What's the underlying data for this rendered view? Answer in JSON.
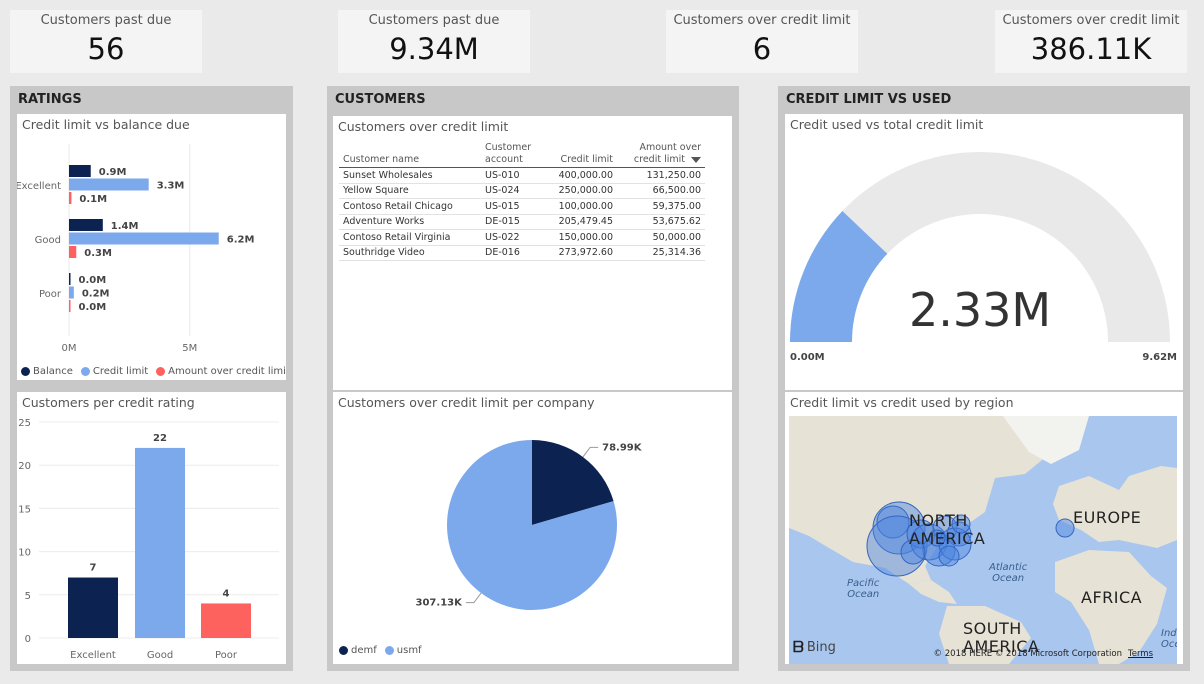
{
  "kpis": [
    {
      "label": "Customers past due",
      "value": "56"
    },
    {
      "label": "Customers past due",
      "value": "9.34M"
    },
    {
      "label": "Customers over credit limit",
      "value": "6"
    },
    {
      "label": "Customers over credit limit",
      "value": "386.11K"
    }
  ],
  "groups": {
    "ratings": "RATINGS",
    "customers": "CUSTOMERS",
    "credit": "CREDIT LIMIT VS USED"
  },
  "colors": {
    "balance": "#0c2352",
    "credit_limit": "#7ca9ec",
    "over_limit": "#fd625e"
  },
  "credit_balance_chart": {
    "title": "Credit limit vs balance due",
    "legend": [
      "Balance",
      "Credit limit",
      "Amount over credit limit"
    ],
    "x_ticks": [
      "0M",
      "5M"
    ]
  },
  "rating_count_chart": {
    "title": "Customers per credit rating",
    "y_ticks": [
      "0",
      "5",
      "10",
      "15",
      "20",
      "25"
    ]
  },
  "customers_table": {
    "title": "Customers over credit limit",
    "headers": [
      "Customer name",
      "Customer account",
      "Credit limit",
      "Amount over credit limit"
    ],
    "rows": [
      [
        "Sunset Wholesales",
        "US-010",
        "400,000.00",
        "131,250.00"
      ],
      [
        "Yellow Square",
        "US-024",
        "250,000.00",
        "66,500.00"
      ],
      [
        "Contoso Retail Chicago",
        "US-015",
        "100,000.00",
        "59,375.00"
      ],
      [
        "Adventure Works",
        "DE-015",
        "205,479.45",
        "53,675.62"
      ],
      [
        "Contoso Retail Virginia",
        "US-022",
        "150,000.00",
        "50,000.00"
      ],
      [
        "Southridge Video",
        "DE-016",
        "273,972.60",
        "25,314.36"
      ]
    ]
  },
  "pie_chart": {
    "title": "Customers over credit limit per company",
    "legend": [
      "demf",
      "usmf"
    ]
  },
  "gauge_chart": {
    "title": "Credit used vs total credit limit",
    "value_label": "2.33M",
    "min_label": "0.00M",
    "max_label": "9.62M"
  },
  "map": {
    "title": "Credit limit vs credit used by region",
    "labels": {
      "north_america": "NORTH\nAMERICA",
      "south_america": "SOUTH\nAMERICA",
      "europe": "EUROPE",
      "africa": "AFRICA",
      "pacific": "Pacific\nOcean",
      "atlantic": "Atlantic\nOcean",
      "indian": "Ind\nOce"
    },
    "bing": "Bing",
    "attribution": "© 2018 HERE  © 2018 Microsoft Corporation",
    "terms": "Terms"
  },
  "chart_data": [
    {
      "type": "bar",
      "orientation": "horizontal",
      "title": "Credit limit vs balance due",
      "categories": [
        "Excellent",
        "Good",
        "Poor"
      ],
      "series": [
        {
          "name": "Balance",
          "values": [
            0.9,
            1.4,
            0.0
          ],
          "labels": [
            "0.9M",
            "1.4M",
            "0.0M"
          ]
        },
        {
          "name": "Credit limit",
          "values": [
            3.3,
            6.2,
            0.2
          ],
          "labels": [
            "3.3M",
            "6.2M",
            "0.2M"
          ]
        },
        {
          "name": "Amount over credit limit",
          "values": [
            0.1,
            0.3,
            0.0
          ],
          "labels": [
            "0.1M",
            "0.3M",
            "0.0M"
          ]
        }
      ],
      "xlim": [
        0,
        5.3
      ],
      "legend": "bottom"
    },
    {
      "type": "bar",
      "title": "Customers per credit rating",
      "categories": [
        "Excellent",
        "Good",
        "Poor"
      ],
      "values": [
        7,
        22,
        4
      ],
      "ylim": [
        0,
        25
      ]
    },
    {
      "type": "pie",
      "title": "Customers over credit limit per company",
      "categories": [
        "demf",
        "usmf"
      ],
      "values": [
        78.99,
        307.13
      ],
      "labels": [
        "78.99K",
        "307.13K"
      ],
      "legend": "bottom-left"
    },
    {
      "type": "gauge",
      "title": "Credit used vs total credit limit",
      "value": 2.33,
      "min": 0,
      "max": 9.62
    }
  ]
}
